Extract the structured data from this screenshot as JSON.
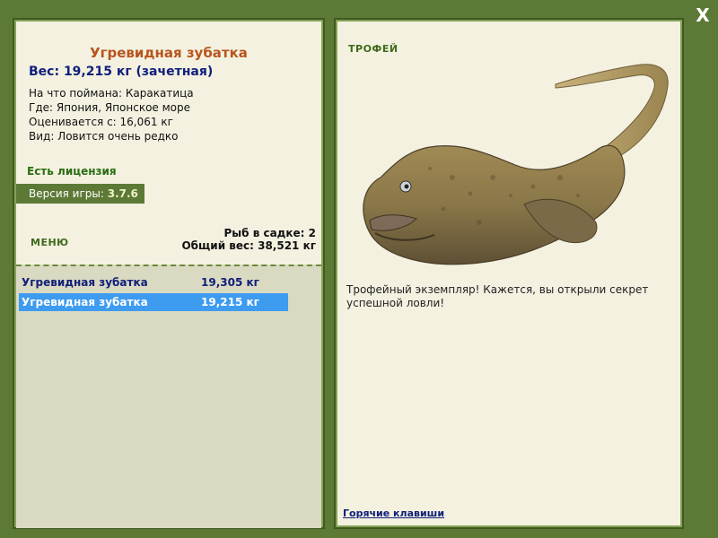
{
  "fish": {
    "name": "Угревидная зубатка",
    "weight": "Вес: 19,215 кг (зачетная)",
    "caught_on": "На что поймана: Каракатица",
    "where": "Где: Япония, Японское море",
    "value_from": "Оценивается с: 16,061 кг",
    "kind": "Вид: Ловится очень редко"
  },
  "license": "Есть лицензия",
  "version": {
    "label": "Версия игры: ",
    "value": "3.7.6"
  },
  "menu_label": "МЕНЮ",
  "keepnet": {
    "count": "Рыб в садке: 2",
    "total": "Общий вес: 38,521 кг"
  },
  "catches": [
    {
      "name": "Угревидная зубатка",
      "weight": "19,305 кг",
      "selected": false
    },
    {
      "name": "Угревидная зубатка",
      "weight": "19,215 кг",
      "selected": true
    }
  ],
  "trophy": {
    "label": "ТРОФЕЙ",
    "text": "Трофейный экземпляр! Кажется, вы открыли секрет успешной ловли!"
  },
  "hotkeys": "Горячие клавиши",
  "close": "X",
  "colors": {
    "frame": "#5c7a36",
    "panel": "#f4f1e1",
    "title": "#b8541c",
    "selection": "#3d9bf0"
  }
}
